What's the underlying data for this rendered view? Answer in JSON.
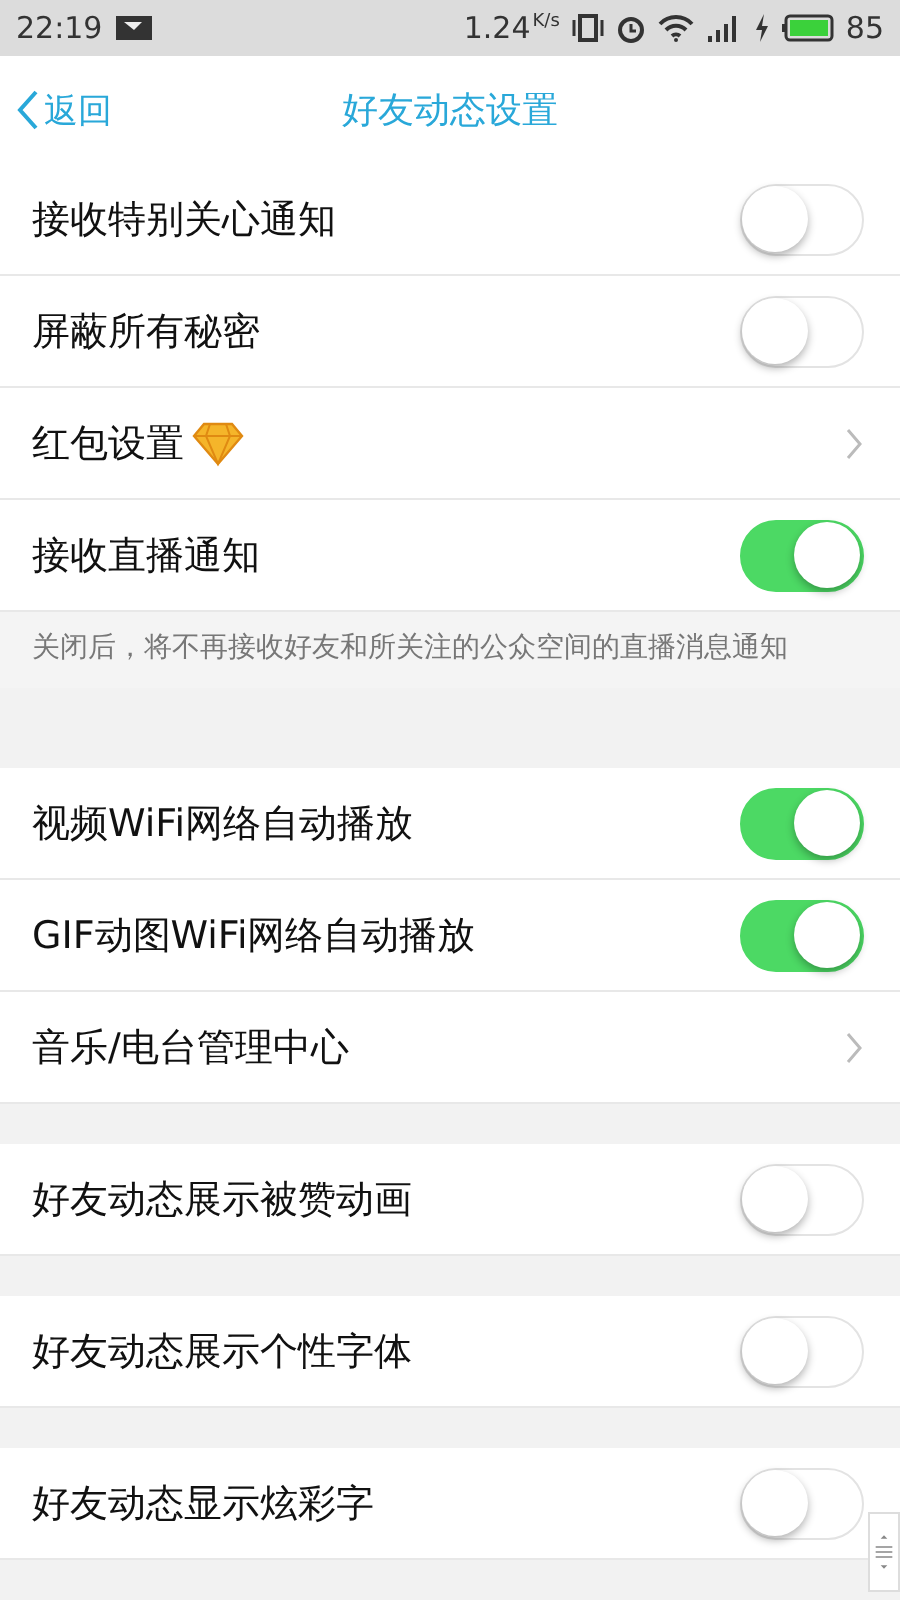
{
  "status_bar": {
    "time": "22:19",
    "speed": "1.24",
    "speed_unit": "K/s",
    "battery": "85"
  },
  "nav": {
    "back": "返回",
    "title": "好友动态设置"
  },
  "groups": [
    {
      "rows": [
        {
          "kind": "toggle",
          "label": "接收特别关心通知",
          "on": false
        },
        {
          "kind": "toggle",
          "label": "屏蔽所有秘密",
          "on": false
        },
        {
          "kind": "link",
          "label": "红包设置",
          "vip_icon": true
        },
        {
          "kind": "toggle",
          "label": "接收直播通知",
          "on": true
        }
      ],
      "note": "关闭后，将不再接收好友和所关注的公众空间的直播消息通知"
    },
    {
      "rows": [
        {
          "kind": "toggle",
          "label": "视频WiFi网络自动播放",
          "on": true
        },
        {
          "kind": "toggle",
          "label": "GIF动图WiFi网络自动播放",
          "on": true
        },
        {
          "kind": "link",
          "label": "音乐/电台管理中心"
        }
      ]
    },
    {
      "rows": [
        {
          "kind": "toggle",
          "label": "好友动态展示被赞动画",
          "on": false
        }
      ]
    },
    {
      "rows": [
        {
          "kind": "toggle",
          "label": "好友动态展示个性字体",
          "on": false
        }
      ]
    },
    {
      "rows": [
        {
          "kind": "toggle",
          "label": "好友动态显示炫彩字",
          "on": false
        }
      ]
    }
  ]
}
